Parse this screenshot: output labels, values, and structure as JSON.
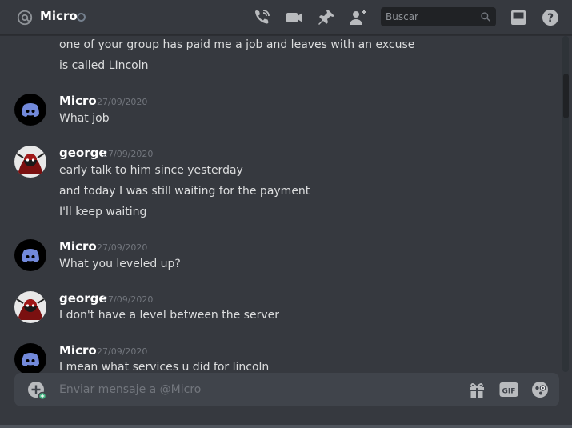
{
  "header": {
    "title": "Micro",
    "search_placeholder": "Buscar",
    "icons": [
      "at-icon",
      "call-icon",
      "video-icon",
      "pin-icon",
      "add-friend-icon",
      "search-icon",
      "inbox-icon",
      "help-icon"
    ]
  },
  "colors": {
    "background": "#36393f",
    "header_bg": "#36393f",
    "input_bg": "#40444b",
    "search_bg": "#202225",
    "username": "#ffffff",
    "text": "#dcddde",
    "timestamp": "#72767d",
    "discord_blurple": "#7289da"
  },
  "messages": [
    {
      "lines": [
        "one of your group has paid me a job and leaves with an excuse",
        "is called LIncoln"
      ]
    },
    {
      "author": "Micro",
      "timestamp": "27/09/2020",
      "lines": [
        "What job"
      ]
    },
    {
      "author": "george",
      "timestamp": "27/09/2020",
      "lines": [
        "early talk to him since yesterday",
        "and today I was still waiting for the payment",
        "I'll keep waiting"
      ]
    },
    {
      "author": "Micro",
      "timestamp": "27/09/2020",
      "lines": [
        "What you leveled up?"
      ]
    },
    {
      "author": "george",
      "timestamp": "27/09/2020",
      "lines": [
        "I don't have a level between the server"
      ]
    },
    {
      "author": "Micro",
      "timestamp": "27/09/2020",
      "lines": [
        "I mean what services u did for lincoln"
      ]
    }
  ],
  "composer": {
    "placeholder": "Enviar mensaje a @Micro",
    "icons": [
      "add-attachment-icon",
      "gift-icon",
      "gif-icon",
      "emoji-icon"
    ]
  }
}
